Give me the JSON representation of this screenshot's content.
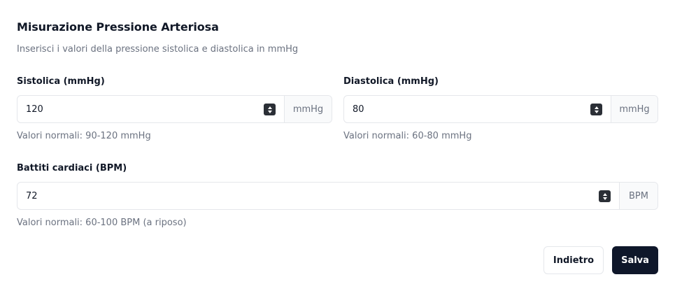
{
  "header": {
    "title": "Misurazione Pressione Arteriosa",
    "subtitle": "Inserisci i valori della pressione sistolica e diastolica in mmHg"
  },
  "systolic": {
    "label": "Sistolica (mmHg)",
    "value": "120",
    "unit": "mmHg",
    "hint": "Valori normali: 90-120 mmHg"
  },
  "diastolic": {
    "label": "Diastolica (mmHg)",
    "value": "80",
    "unit": "mmHg",
    "hint": "Valori normali: 60-80 mmHg"
  },
  "heart_rate": {
    "label": "Battiti cardiaci (BPM)",
    "value": "72",
    "unit": "BPM",
    "hint": "Valori normali: 60-100 BPM (a riposo)"
  },
  "actions": {
    "back_label": "Indietro",
    "save_label": "Salva"
  },
  "colors": {
    "primary_button": "#0f172a",
    "muted_text": "#6b7280",
    "border": "#e5e7eb"
  }
}
